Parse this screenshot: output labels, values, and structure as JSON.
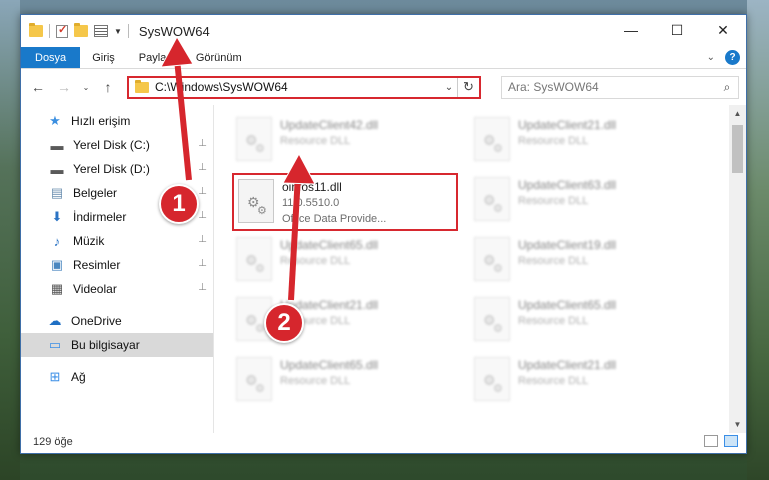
{
  "window": {
    "title": "SysWOW64",
    "controls": {
      "minimize": "—",
      "maximize": "☐",
      "close": "✕"
    }
  },
  "ribbon": {
    "tabs": [
      {
        "label": "Dosya",
        "active": true
      },
      {
        "label": "Giriş"
      },
      {
        "label": "Paylaş"
      },
      {
        "label": "Görünüm"
      }
    ],
    "help_label": "?"
  },
  "navbar": {
    "back": "←",
    "forward": "→",
    "recent": "⌄",
    "up": "↑",
    "address": "C:\\Windows\\SysWOW64",
    "refresh": "↻",
    "search_placeholder": "Ara: SysWOW64",
    "search_icon": "⌕"
  },
  "sidebar": {
    "items": [
      {
        "label": "Hızlı erişim",
        "icon": "star-icon",
        "glyph": "★",
        "color": "#3b8fe0",
        "level": "top"
      },
      {
        "label": "Yerel Disk (C:)",
        "icon": "drive-icon",
        "glyph": "▬",
        "color": "#5a5a5a",
        "level": "sub",
        "pinned": true
      },
      {
        "label": "Yerel Disk (D:)",
        "icon": "drive-icon",
        "glyph": "▬",
        "color": "#5a5a5a",
        "level": "sub",
        "pinned": true
      },
      {
        "label": "Belgeler",
        "icon": "documents-icon",
        "glyph": "▤",
        "color": "#6c8fb0",
        "level": "sub",
        "pinned": true
      },
      {
        "label": "İndirmeler",
        "icon": "download-icon",
        "glyph": "⬇",
        "color": "#2a73c4",
        "level": "sub",
        "pinned": true
      },
      {
        "label": "Müzik",
        "icon": "music-icon",
        "glyph": "♪",
        "color": "#2a73c4",
        "level": "sub",
        "pinned": true
      },
      {
        "label": "Resimler",
        "icon": "pictures-icon",
        "glyph": "▣",
        "color": "#4a87c0",
        "level": "sub",
        "pinned": true
      },
      {
        "label": "Videolar",
        "icon": "videos-icon",
        "glyph": "▦",
        "color": "#555",
        "level": "sub",
        "pinned": true
      },
      {
        "label": "OneDrive",
        "icon": "cloud-icon",
        "glyph": "☁",
        "color": "#1f6fc4",
        "level": "top",
        "gap": true
      },
      {
        "label": "Bu bilgisayar",
        "icon": "computer-icon",
        "glyph": "▭",
        "color": "#3a8ee6",
        "level": "top",
        "selected": true
      },
      {
        "label": "Ağ",
        "icon": "network-icon",
        "glyph": "⊞",
        "color": "#3a8ee6",
        "level": "top",
        "gap": true
      }
    ],
    "pin_glyph": "📌"
  },
  "files": {
    "focused": {
      "name": "oinfos11.dll",
      "version": "11.0.5510.0",
      "description": "Office Data Provide..."
    },
    "background_items": [
      {
        "name": "UpdateClient42.dll",
        "type": "Resource DLL"
      },
      {
        "name": "UpdateClient21.dll",
        "type": "Resource DLL"
      },
      {
        "name": "UpdateClient63.dll",
        "type": "Resource DLL"
      },
      {
        "name": "UpdateClient65.dll",
        "type": "Resource DLL"
      },
      {
        "name": "UpdateClient19.dll",
        "type": "Resource DLL"
      },
      {
        "name": "UpdateClient21.dll",
        "type": "Resource DLL"
      },
      {
        "name": "UpdateClient65.dll",
        "type": "Resource DLL"
      },
      {
        "name": "UpdateClient65.dll",
        "type": "Resource DLL"
      },
      {
        "name": "UpdateClient21.dll",
        "type": "Resource DLL"
      }
    ]
  },
  "status": {
    "count_text": "129 öğe"
  },
  "annotations": [
    {
      "number": "1",
      "color": "#d6262d"
    },
    {
      "number": "2",
      "color": "#d6262d"
    }
  ]
}
